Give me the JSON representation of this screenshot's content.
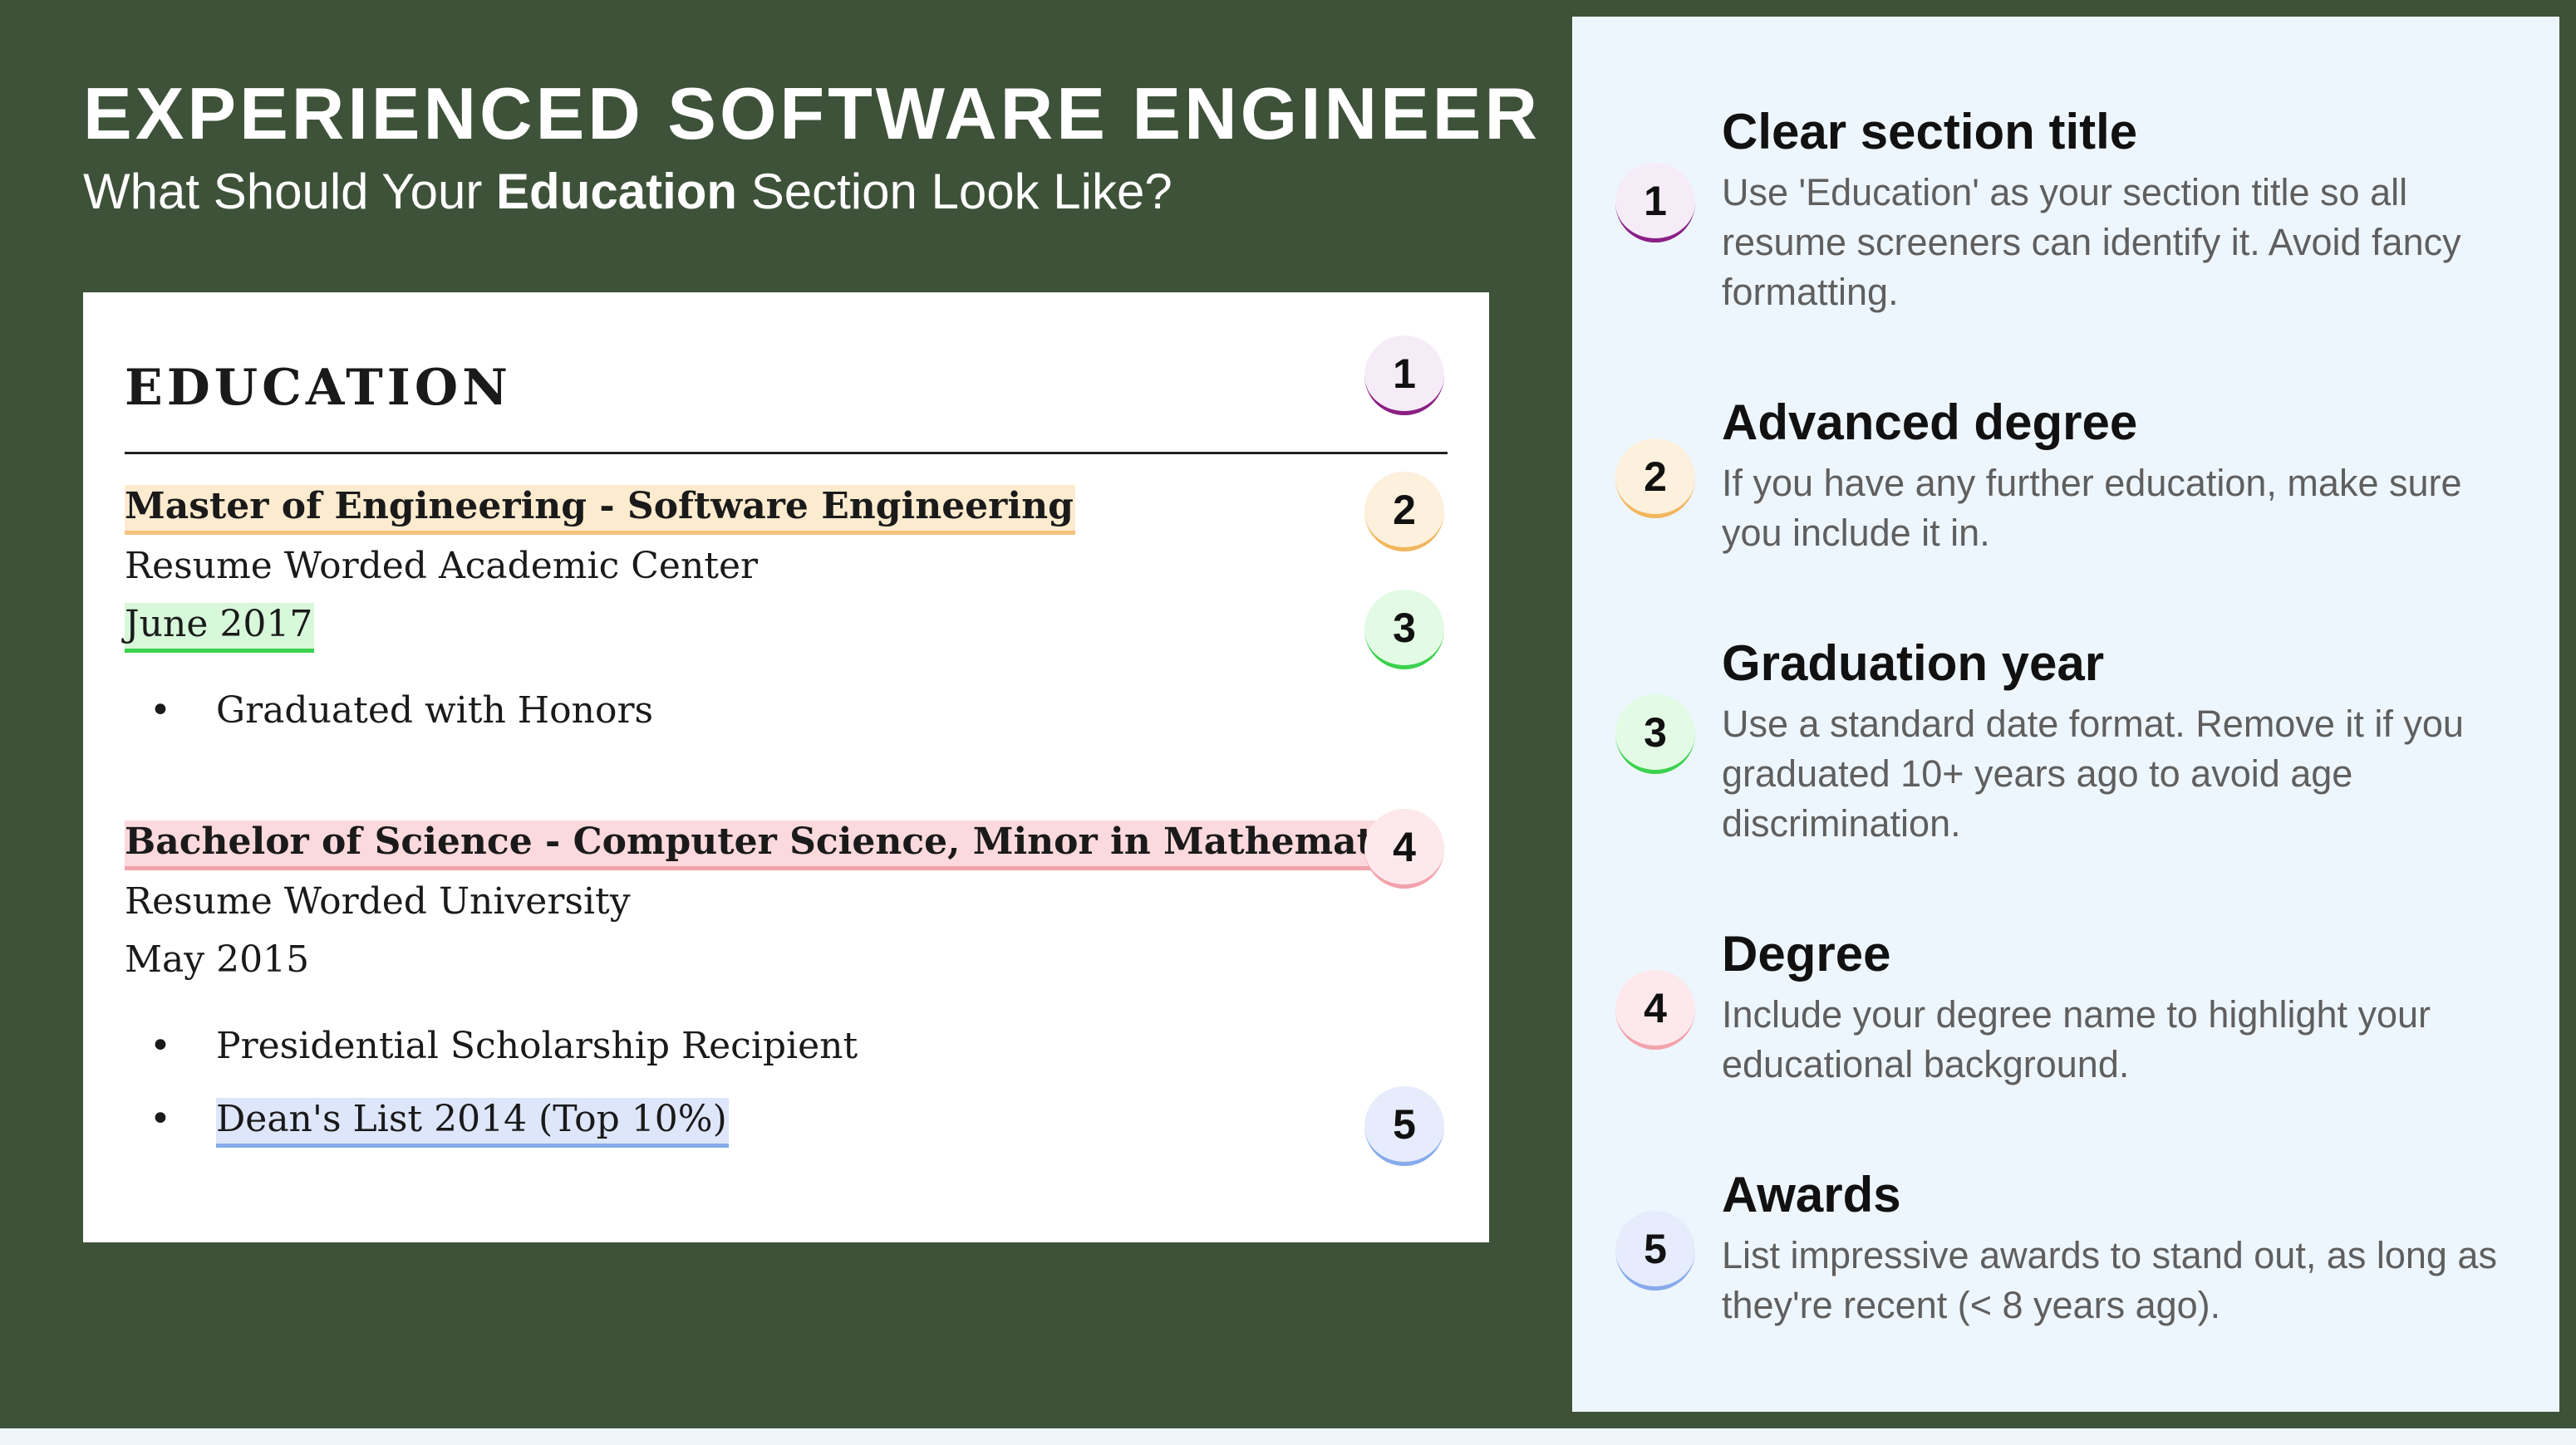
{
  "header": {
    "title": "EXPERIENCED SOFTWARE ENGINEER",
    "subtitle_pre": "What Should Your ",
    "subtitle_bold": "Education",
    "subtitle_post": " Section Look Like?"
  },
  "resume": {
    "section_title": "EDUCATION",
    "entries": [
      {
        "degree": "Master of Engineering - Software Engineering",
        "school": "Resume Worded Academic Center",
        "date": "June 2017",
        "bullets": [
          "Graduated with Honors"
        ]
      },
      {
        "degree": "Bachelor of Science - Computer Science, Minor in Mathematics",
        "school": "Resume Worded University",
        "date": "May 2015",
        "bullets": [
          "Presidential Scholarship Recipient",
          "Dean's List 2014 (Top 10%)"
        ]
      }
    ],
    "bullet_symbol": "•",
    "markers": [
      "1",
      "2",
      "3",
      "4",
      "5"
    ]
  },
  "tips": [
    {
      "number": "1",
      "title": "Clear section title",
      "description": "Use 'Education' as your section title so all resume screeners can identify it. Avoid fancy formatting."
    },
    {
      "number": "2",
      "title": "Advanced degree",
      "description": "If you have any further education, make sure you include it in."
    },
    {
      "number": "3",
      "title": "Graduation year",
      "description": "Use a standard date format. Remove it if you graduated 10+ years ago to avoid age discrimination."
    },
    {
      "number": "4",
      "title": "Degree",
      "description": "Include your degree name to highlight your educational background."
    },
    {
      "number": "5",
      "title": "Awards",
      "description": "List impressive awards to stand out, as long as they're recent (< 8 years ago)."
    }
  ],
  "colors": {
    "background": "#3e5239",
    "panel": "#eef6fd",
    "tip1": "#8a1f84",
    "tip2": "#f2b65e",
    "tip3": "#3bd24e",
    "tip4": "#f2a3ac",
    "tip5": "#86aaea"
  }
}
